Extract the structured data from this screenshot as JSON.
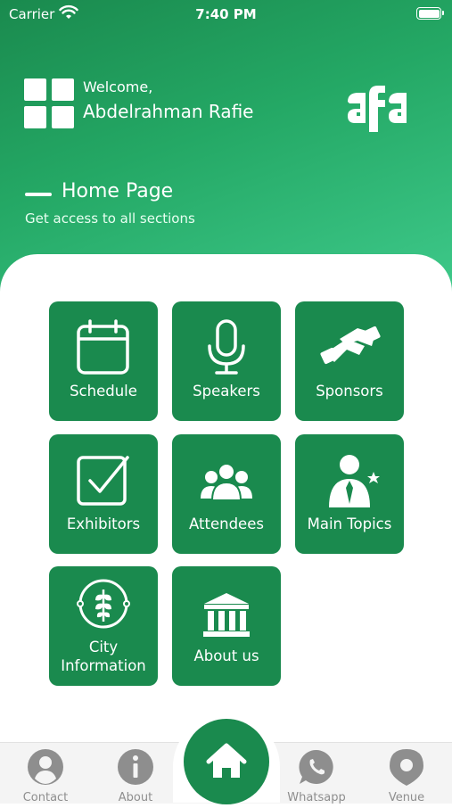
{
  "status_bar": {
    "carrier": "Carrier",
    "time": "7:40 PM"
  },
  "header": {
    "welcome": "Welcome,",
    "username": "Abdelrahman Rafie",
    "logo_text": "afa",
    "page_title": "Home Page",
    "page_subtitle": "Get access to all sections"
  },
  "tiles": [
    {
      "label": "Schedule",
      "icon": "calendar-icon"
    },
    {
      "label": "Speakers",
      "icon": "microphone-icon"
    },
    {
      "label": "Sponsors",
      "icon": "handshake-icon"
    },
    {
      "label": "Exhibitors",
      "icon": "checkbox-icon"
    },
    {
      "label": "Attendees",
      "icon": "people-icon"
    },
    {
      "label": "Main Topics",
      "icon": "person-star-icon"
    },
    {
      "label_line1": "City",
      "label_line2": "Information",
      "icon": "city-leaf-icon"
    },
    {
      "label": "About us",
      "icon": "museum-icon"
    }
  ],
  "tabbar": {
    "contact": "Contact",
    "about": "About",
    "home_icon": "home-icon",
    "whatsapp": "Whatsapp",
    "venue": "Venue"
  },
  "colors": {
    "brand_green": "#1a8a4e",
    "header_light": "#3ec98a",
    "tab_gray": "#8e8e8e"
  }
}
